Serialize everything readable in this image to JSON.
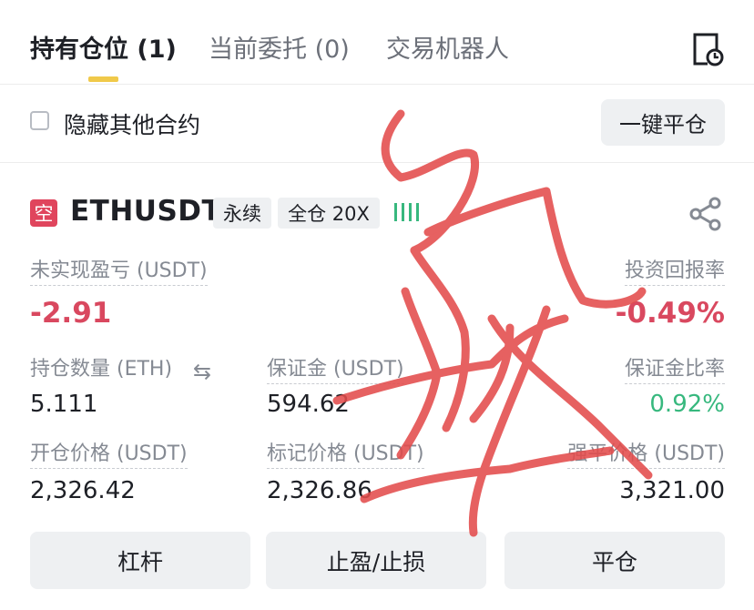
{
  "tabs": {
    "positions": "持有仓位 (1)",
    "open_orders": "当前委托 (0)",
    "trading_bots": "交易机器人"
  },
  "controls": {
    "hide_other_symbols": "隐藏其他合约",
    "close_all": "一键平仓"
  },
  "position": {
    "side_badge": "空",
    "symbol": "ETHUSDT",
    "contract_type": "永续",
    "margin_mode": "全仓 20X",
    "unrealized_pnl_label": "未实现盈亏 (USDT)",
    "unrealized_pnl": "-2.91",
    "roi_label": "投资回报率",
    "roi": "-0.49%",
    "size_label": "持仓数量 (ETH)",
    "size": "5.111",
    "margin_label": "保证金 (USDT)",
    "margin": "594.62",
    "margin_ratio_label": "保证金比率",
    "margin_ratio": "0.92%",
    "entry_price_label": "开仓价格 (USDT)",
    "entry_price": "2,326.42",
    "mark_price_label": "标记价格 (USDT)",
    "mark_price": "2,326.86",
    "liq_price_label": "强平价格 (USDT)",
    "liq_price": "3,321.00"
  },
  "actions": {
    "leverage": "杠杆",
    "tp_sl": "止盈/止损",
    "close": "平仓"
  },
  "colors": {
    "accent_yellow": "#f0c94a",
    "short_red": "#e0455d",
    "profit_green": "#37b87e",
    "scribble_red": "#e34c4c"
  },
  "icons": {
    "history": "history-clock-icon",
    "share": "share-icon",
    "swap": "swap-arrows-icon",
    "adl": "adl-indicator-icon"
  }
}
